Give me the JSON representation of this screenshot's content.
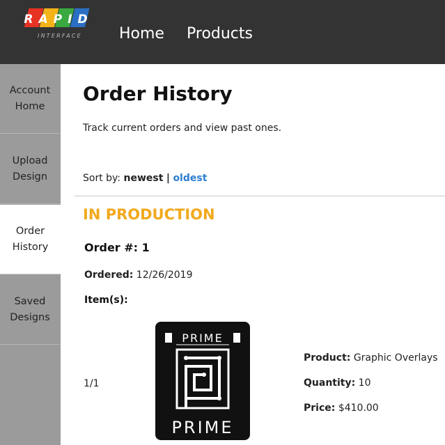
{
  "header": {
    "logo_text": "RAPID",
    "logo_subtext": "INTERFACE",
    "nav": [
      {
        "label": "Home"
      },
      {
        "label": "Products"
      }
    ]
  },
  "sidebar": {
    "items": [
      {
        "line1": "Account",
        "line2": "Home",
        "active": false
      },
      {
        "line1": "Upload",
        "line2": "Design",
        "active": false
      },
      {
        "line1": "Order",
        "line2": "History",
        "active": true
      },
      {
        "line1": "Saved",
        "line2": "Designs",
        "active": false
      }
    ]
  },
  "main": {
    "title": "Order History",
    "subtitle": "Track current orders and view past ones.",
    "sort": {
      "label": "Sort by:",
      "current": "newest",
      "separator": "|",
      "other": "oldest"
    },
    "section_title": "IN PRODUCTION",
    "order": {
      "number_label": "Order #: 1",
      "ordered_label": "Ordered:",
      "ordered_value": "12/26/2019",
      "items_label": "Item(s):",
      "item": {
        "index": "1/1",
        "image_text_top": "PRIME",
        "image_text_bottom": "PRIME",
        "product_label": "Product:",
        "product_value": "Graphic Overlays",
        "quantity_label": "Quantity:",
        "quantity_value": "10",
        "price_label": "Price:",
        "price_value": "$410.00"
      }
    }
  },
  "colors": {
    "header_bg": "#333333",
    "sidebar_bg": "#9b9b9b",
    "accent_orange": "#f2a91d",
    "link_blue": "#2c7fd0"
  }
}
